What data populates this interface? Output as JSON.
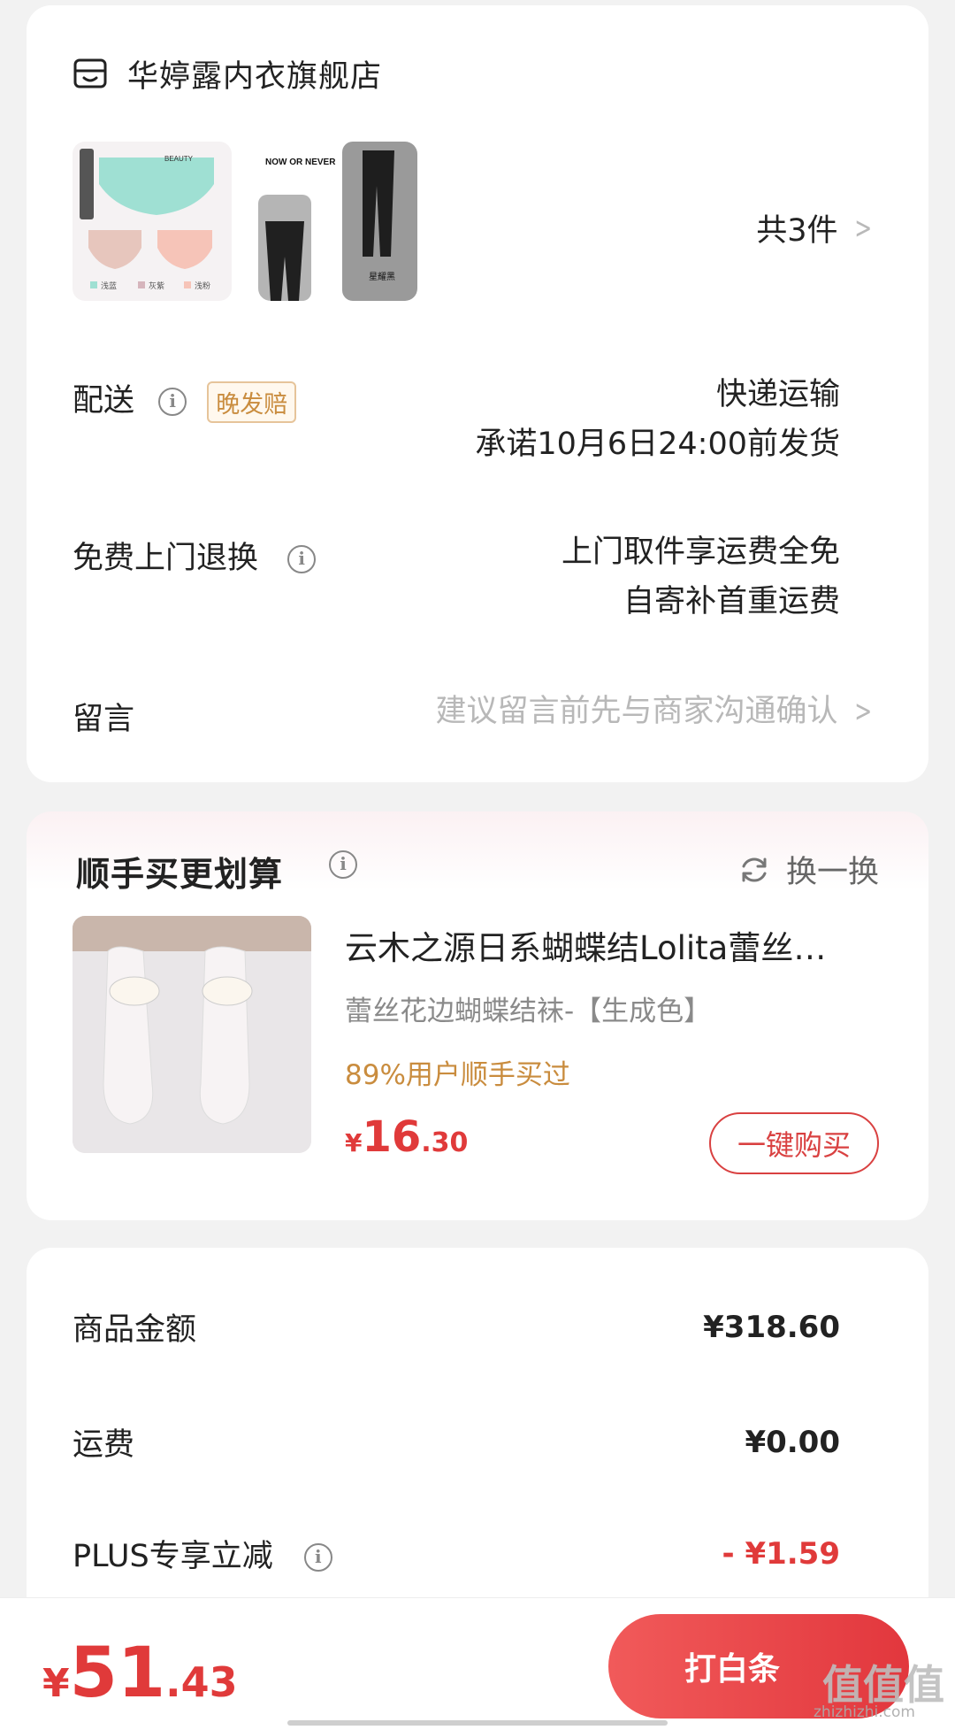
{
  "store": {
    "name": "华婷露内衣旗舰店",
    "count_label": "共3件",
    "thumb1": {
      "brand": "BEAUTY",
      "colors": [
        "浅蓝",
        "灰紫",
        "浅粉"
      ]
    },
    "thumb2": {
      "headline": "NOW OR NEVER",
      "color_label": "星耀黑"
    }
  },
  "delivery": {
    "label": "配送",
    "badge": "晚发赔",
    "method": "快递运输",
    "promise": "承诺10月6日24:00前发货"
  },
  "returns": {
    "label": "免费上门退换",
    "line1": "上门取件享运费全免",
    "line2": "自寄补首重运费"
  },
  "note": {
    "label": "留言",
    "placeholder": "建议留言前先与商家沟通确认"
  },
  "upsell": {
    "title": "顺手买更划算",
    "refresh_label": "换一换",
    "product_name": "云木之源日系蝴蝶结Lolita蕾丝花边袜",
    "product_spec": "蕾丝花边蝴蝶结袜-【生成色】",
    "product_tag": "89%用户顺手买过",
    "price_currency": "¥",
    "price_int": "16",
    "price_dec": ".30",
    "buy_label": "一键购买"
  },
  "summary": {
    "rows": [
      {
        "label": "商品金额",
        "value": "¥318.60"
      },
      {
        "label": "运费",
        "value": "¥0.00"
      },
      {
        "label": "PLUS专享立减",
        "value": "- ¥1.59"
      }
    ]
  },
  "footer": {
    "total_currency": "¥",
    "total_int": "51",
    "total_dec": ".43",
    "pay_label": "打白条",
    "watermark": "值值值",
    "watermark_sub": "zhizhizhi.com"
  },
  "colors": {
    "accent_red": "#e03a3a",
    "gold": "#c98c3e"
  }
}
